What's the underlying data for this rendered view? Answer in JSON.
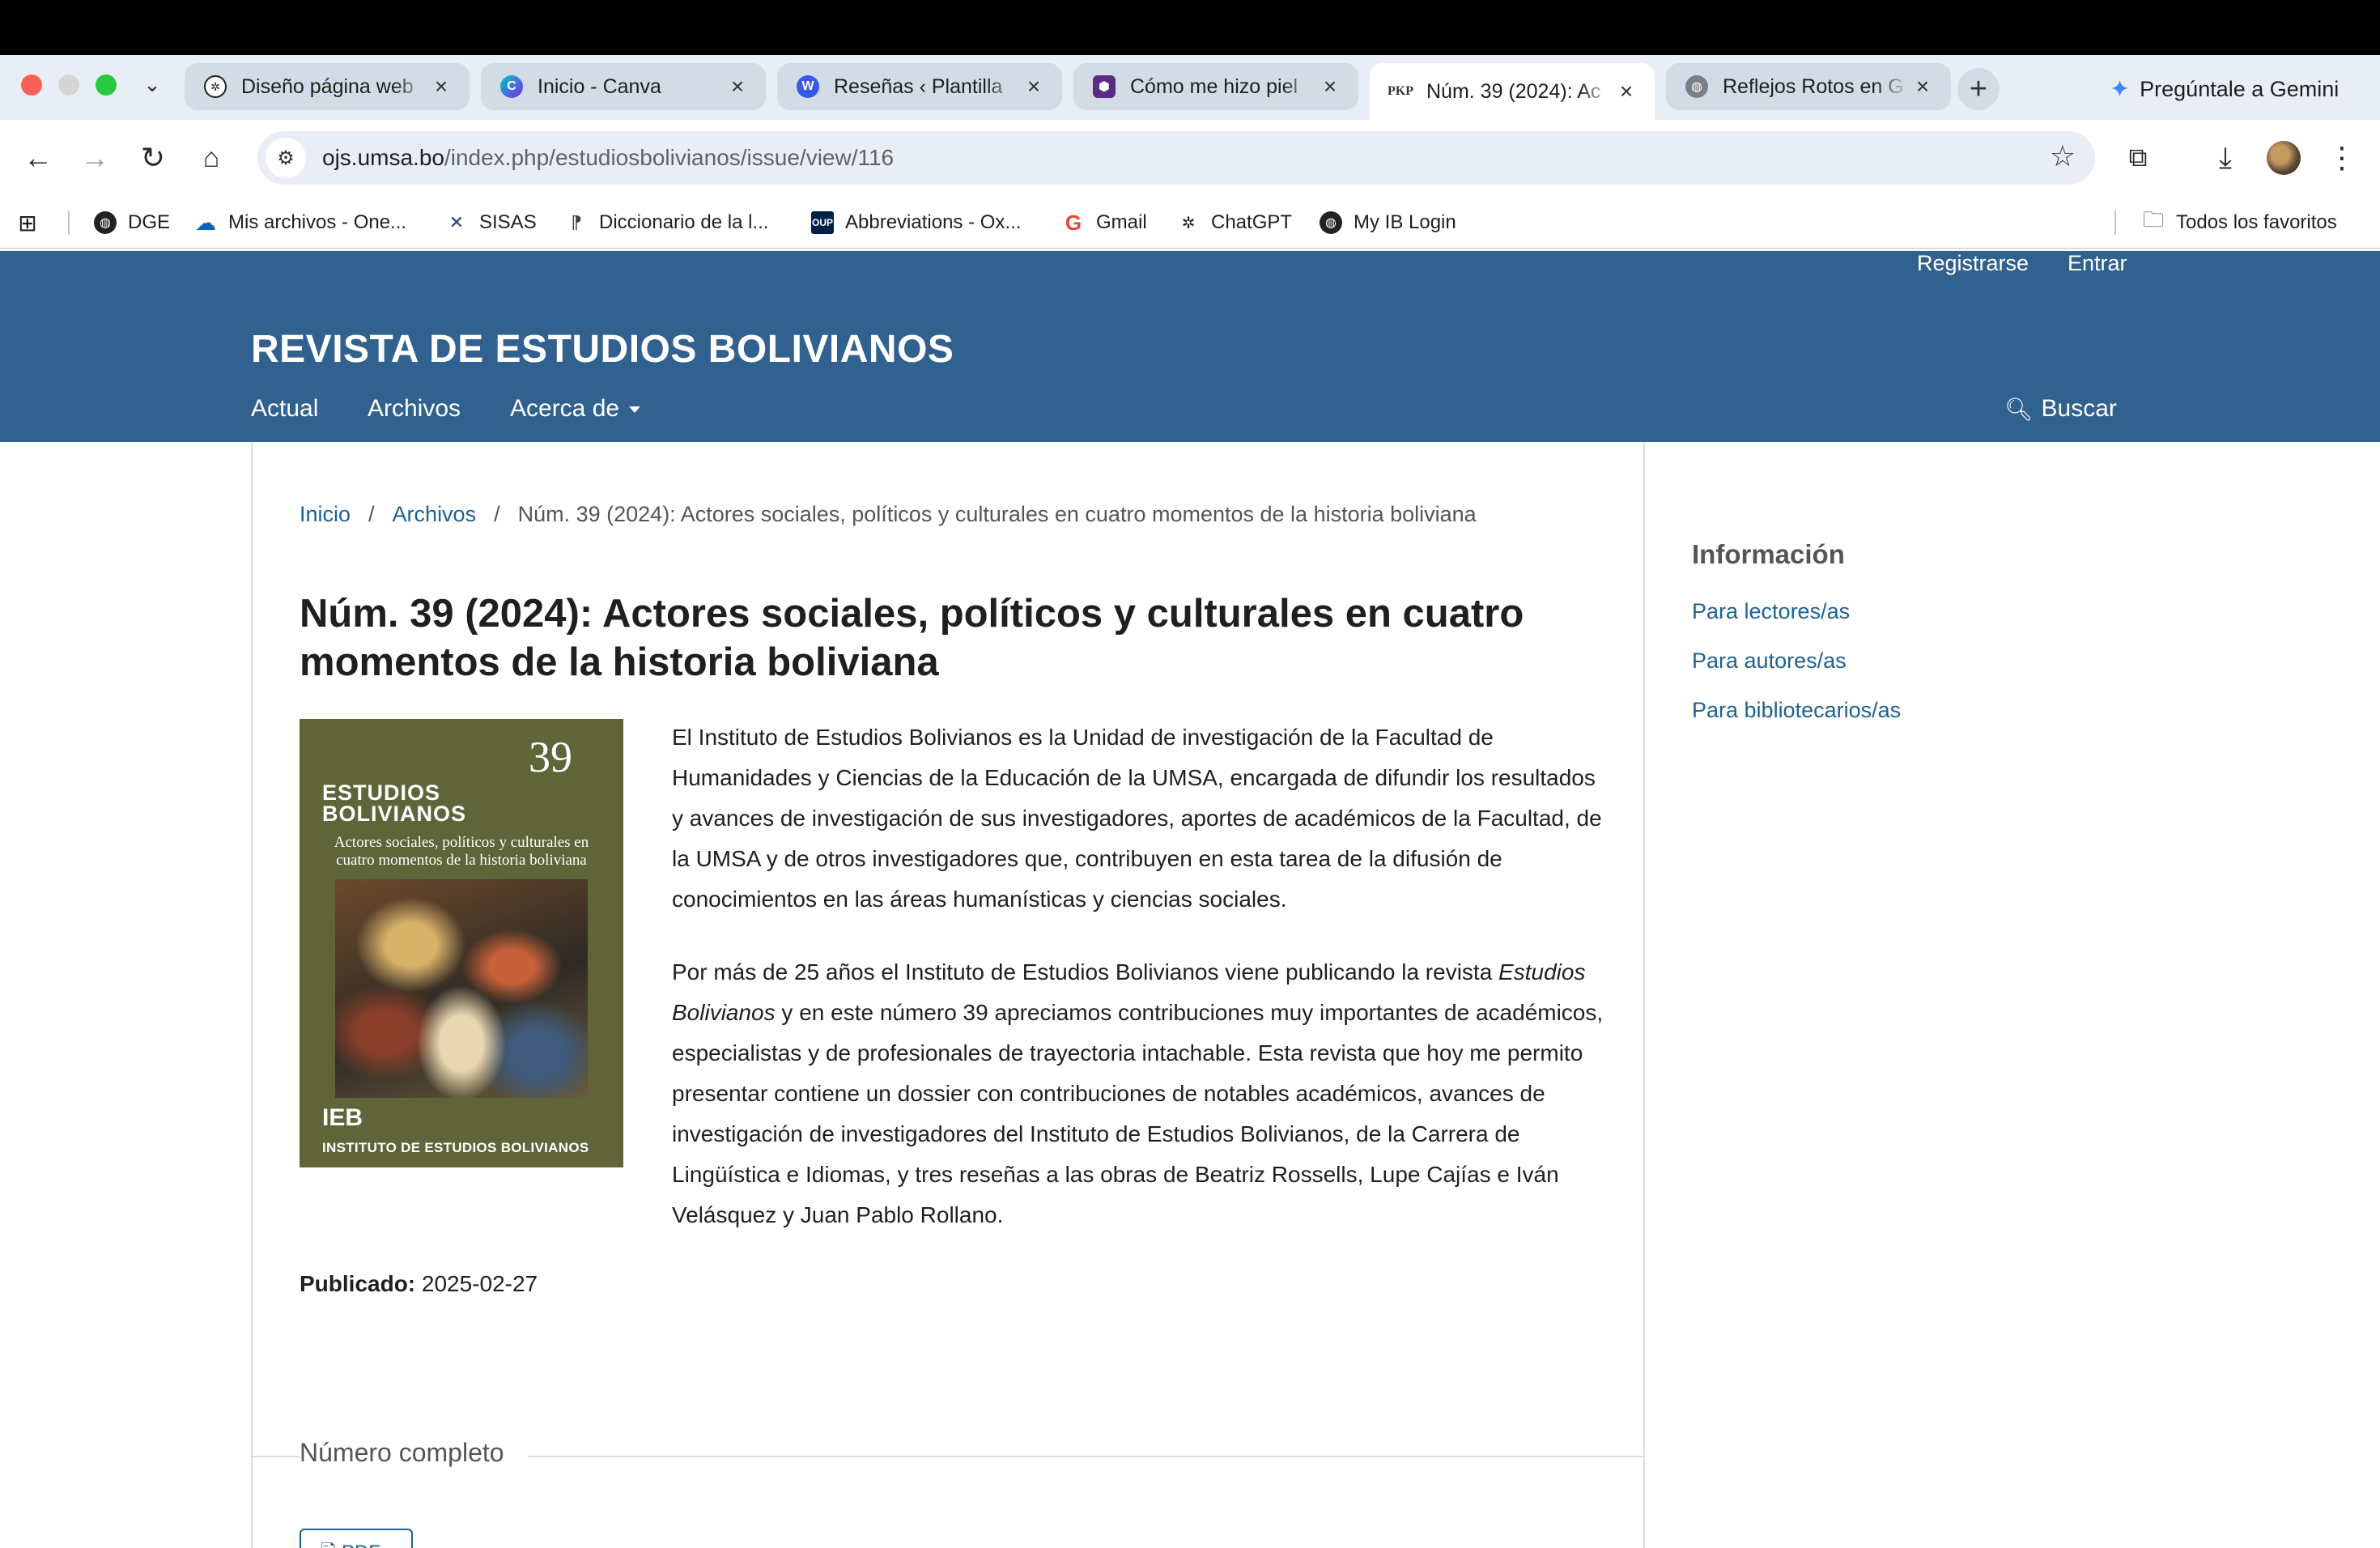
{
  "browser": {
    "tabs": [
      {
        "title": "Diseño página web",
        "favicon": "openai-icon"
      },
      {
        "title": "Inicio - Canva",
        "favicon": "canva-icon"
      },
      {
        "title": "Reseñas ‹ Plantilla",
        "favicon": "wordpress-icon"
      },
      {
        "title": "Cómo me hizo piel",
        "favicon": "hexagon-icon"
      },
      {
        "title": "Núm. 39 (2024): Ac",
        "favicon": "pkp-icon"
      },
      {
        "title": "Reflejos Rotos en G",
        "favicon": "globe-icon"
      }
    ],
    "gemini_label": "Pregúntale a Gemini",
    "url_domain": "ojs.umsa.bo",
    "url_path": "/index.php/estudiosbolivianos/issue/view/116",
    "bookmarks": [
      {
        "label": "DGE"
      },
      {
        "label": "Mis archivos - One..."
      },
      {
        "label": "SISAS"
      },
      {
        "label": "Diccionario de la l..."
      },
      {
        "label": "Abbreviations - Ox..."
      },
      {
        "label": "Gmail"
      },
      {
        "label": "ChatGPT"
      },
      {
        "label": "My IB Login"
      }
    ],
    "all_bookmarks_label": "Todos los favoritos",
    "pkp_favicon_text": "PKP",
    "oup_favicon_text": "OUP"
  },
  "header": {
    "register": "Registrarse",
    "login": "Entrar",
    "site_title": "REVISTA DE ESTUDIOS BOLIVIANOS",
    "nav": {
      "current": "Actual",
      "archives": "Archivos",
      "about": "Acerca de"
    },
    "search": "Buscar"
  },
  "breadcrumb": {
    "home": "Inicio",
    "archives": "Archivos",
    "current": "Núm. 39 (2024): Actores sociales, políticos y culturales en cuatro momentos de la historia boliviana"
  },
  "issue": {
    "title": "Núm. 39 (2024): Actores sociales, políticos y culturales en cuatro momentos de la historia boliviana",
    "cover": {
      "number": "39",
      "journal_line1": "ESTUDIOS",
      "journal_line2": "BOLIVIANOS",
      "subtitle": "Actores sociales, políticos y culturales en cuatro momentos de la historia boliviana",
      "logo": "IEB",
      "institute": "INSTITUTO DE ESTUDIOS BOLIVIANOS"
    },
    "paragraph1": "El Instituto de Estudios Bolivianos es la Unidad de investigación de la Facultad de Humanidades y Ciencias de la Educación de la UMSA, encargada de difundir los resultados y avances de investigación de sus investigadores, aportes de académicos de la Facultad, de la UMSA y de otros investigadores que, contribuyen en esta tarea de la difusión de conocimientos en las áreas humanísticas y ciencias sociales.",
    "paragraph2_start": "Por más de 25 años el Instituto de Estudios Bolivianos viene publicando la revista ",
    "paragraph2_italic": "Estudios Bolivianos",
    "paragraph2_end": " y en este número 39 apreciamos contribuciones muy importantes de académicos, especialistas y de profesionales de trayectoria intachable. Esta revista que hoy me permito presentar contiene un dossier con contribuciones de notables académicos, avances de investigación de investigadores del Instituto de Estudios Bolivianos, de la Carrera de Lingüística e Idiomas, y tres reseñas a las obras de Beatriz Rossells, Lupe Cajías e Iván Velásquez y Juan Pablo Rollano.",
    "published_label": "Publicado:",
    "published_date": "2025-02-27",
    "full_issue_label": "Número completo",
    "pdf_label": "PDF"
  },
  "sidebar": {
    "title": "Información",
    "links": [
      "Para lectores/as",
      "Para autores/as",
      "Para bibliotecarios/as"
    ]
  }
}
